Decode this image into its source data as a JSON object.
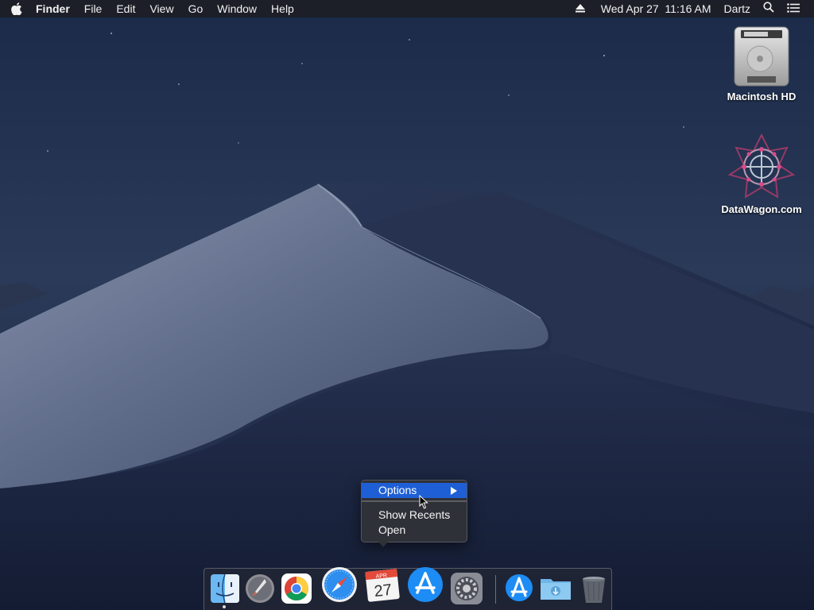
{
  "menubar": {
    "app_name": "Finder",
    "menus": [
      "File",
      "Edit",
      "View",
      "Go",
      "Window",
      "Help"
    ],
    "datetime": "Wed Apr 27  11:16 AM",
    "user": "Dartz",
    "icons": [
      "apple-icon",
      "eject-icon",
      "spotlight-search-icon",
      "notification-center-icon"
    ]
  },
  "desktop": {
    "icons": [
      {
        "label": "Macintosh HD",
        "icon": "hard-drive-icon"
      },
      {
        "label": "DataWagon.com",
        "icon": "datawagon-logo-icon"
      }
    ]
  },
  "context_menu": {
    "items": [
      {
        "label": "Options",
        "highlighted": true,
        "submenu": true
      },
      {
        "label": "Show Recents",
        "highlighted": false,
        "submenu": false
      },
      {
        "label": "Open",
        "highlighted": false,
        "submenu": false
      }
    ]
  },
  "dock": {
    "apps": [
      {
        "icon": "finder-icon",
        "running": true
      },
      {
        "icon": "launchpad-icon",
        "running": false
      },
      {
        "icon": "chrome-icon",
        "running": false
      },
      {
        "icon": "safari-icon",
        "running": false
      },
      {
        "icon": "calendar-icon",
        "running": false,
        "month": "APR",
        "day": "27"
      },
      {
        "icon": "app-store-icon",
        "running": false
      },
      {
        "icon": "system-preferences-icon",
        "running": false
      },
      {
        "icon": "applications-folder-icon",
        "running": false
      },
      {
        "icon": "downloads-folder-icon",
        "running": false
      },
      {
        "icon": "trash-icon",
        "running": false
      }
    ]
  },
  "colors": {
    "menu_highlight": "#1f5fd6",
    "menubar_bg": "#1c1e26",
    "sky": "#1d2b47"
  }
}
